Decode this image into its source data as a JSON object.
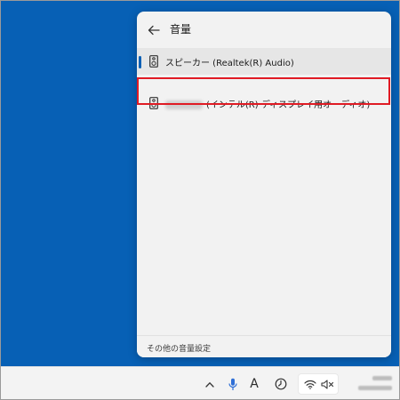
{
  "panel": {
    "title": "音量",
    "devices": [
      {
        "label": "スピーカー (Realtek(R) Audio)",
        "selected": true
      },
      {
        "label": "(インテル(R) ディスプレイ用オーディオ)",
        "selected": false,
        "name_redacted": true
      }
    ],
    "footer_link": "その他の音量設定"
  },
  "taskbar": {
    "ime_label": "A"
  },
  "colors": {
    "desktop": "#0760b5",
    "highlight": "#e01b24",
    "accent": "#0760b5"
  },
  "icons": {
    "back": "arrow-left-icon",
    "speaker": "speaker-icon",
    "chevron": "chevron-up-icon",
    "mic": "microphone-icon",
    "wifi": "wifi-icon",
    "volume": "volume-muted-icon"
  }
}
